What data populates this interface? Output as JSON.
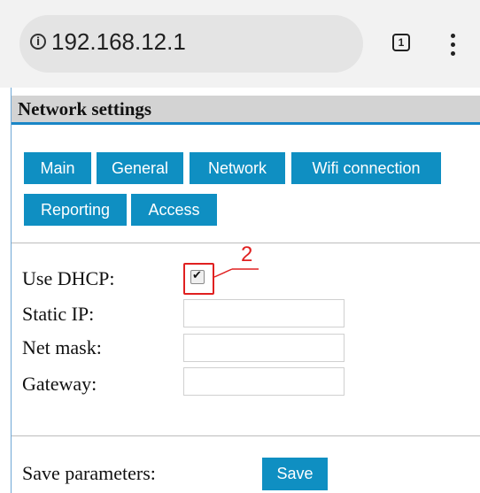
{
  "browser": {
    "url": "192.168.12.1",
    "tab_count": "1",
    "info_icon": "info-icon",
    "menu_icon": "more-vert-icon"
  },
  "page": {
    "title": "Network settings"
  },
  "tabs": [
    {
      "label": "Main"
    },
    {
      "label": "General"
    },
    {
      "label": "Network"
    },
    {
      "label": "Wifi connection"
    },
    {
      "label": "Reporting"
    },
    {
      "label": "Access"
    }
  ],
  "form": {
    "use_dhcp": {
      "label": "Use DHCP:",
      "checked": true
    },
    "static_ip": {
      "label": "Static IP:",
      "value": ""
    },
    "net_mask": {
      "label": "Net mask:",
      "value": ""
    },
    "gateway": {
      "label": "Gateway:",
      "value": ""
    }
  },
  "save": {
    "label": "Save parameters:",
    "button": "Save"
  },
  "annotation": {
    "number": "2",
    "color": "#e02020"
  },
  "colors": {
    "accent": "#0f8fc2",
    "header_bg": "#d3d3d3",
    "header_line": "#1a86c6"
  }
}
